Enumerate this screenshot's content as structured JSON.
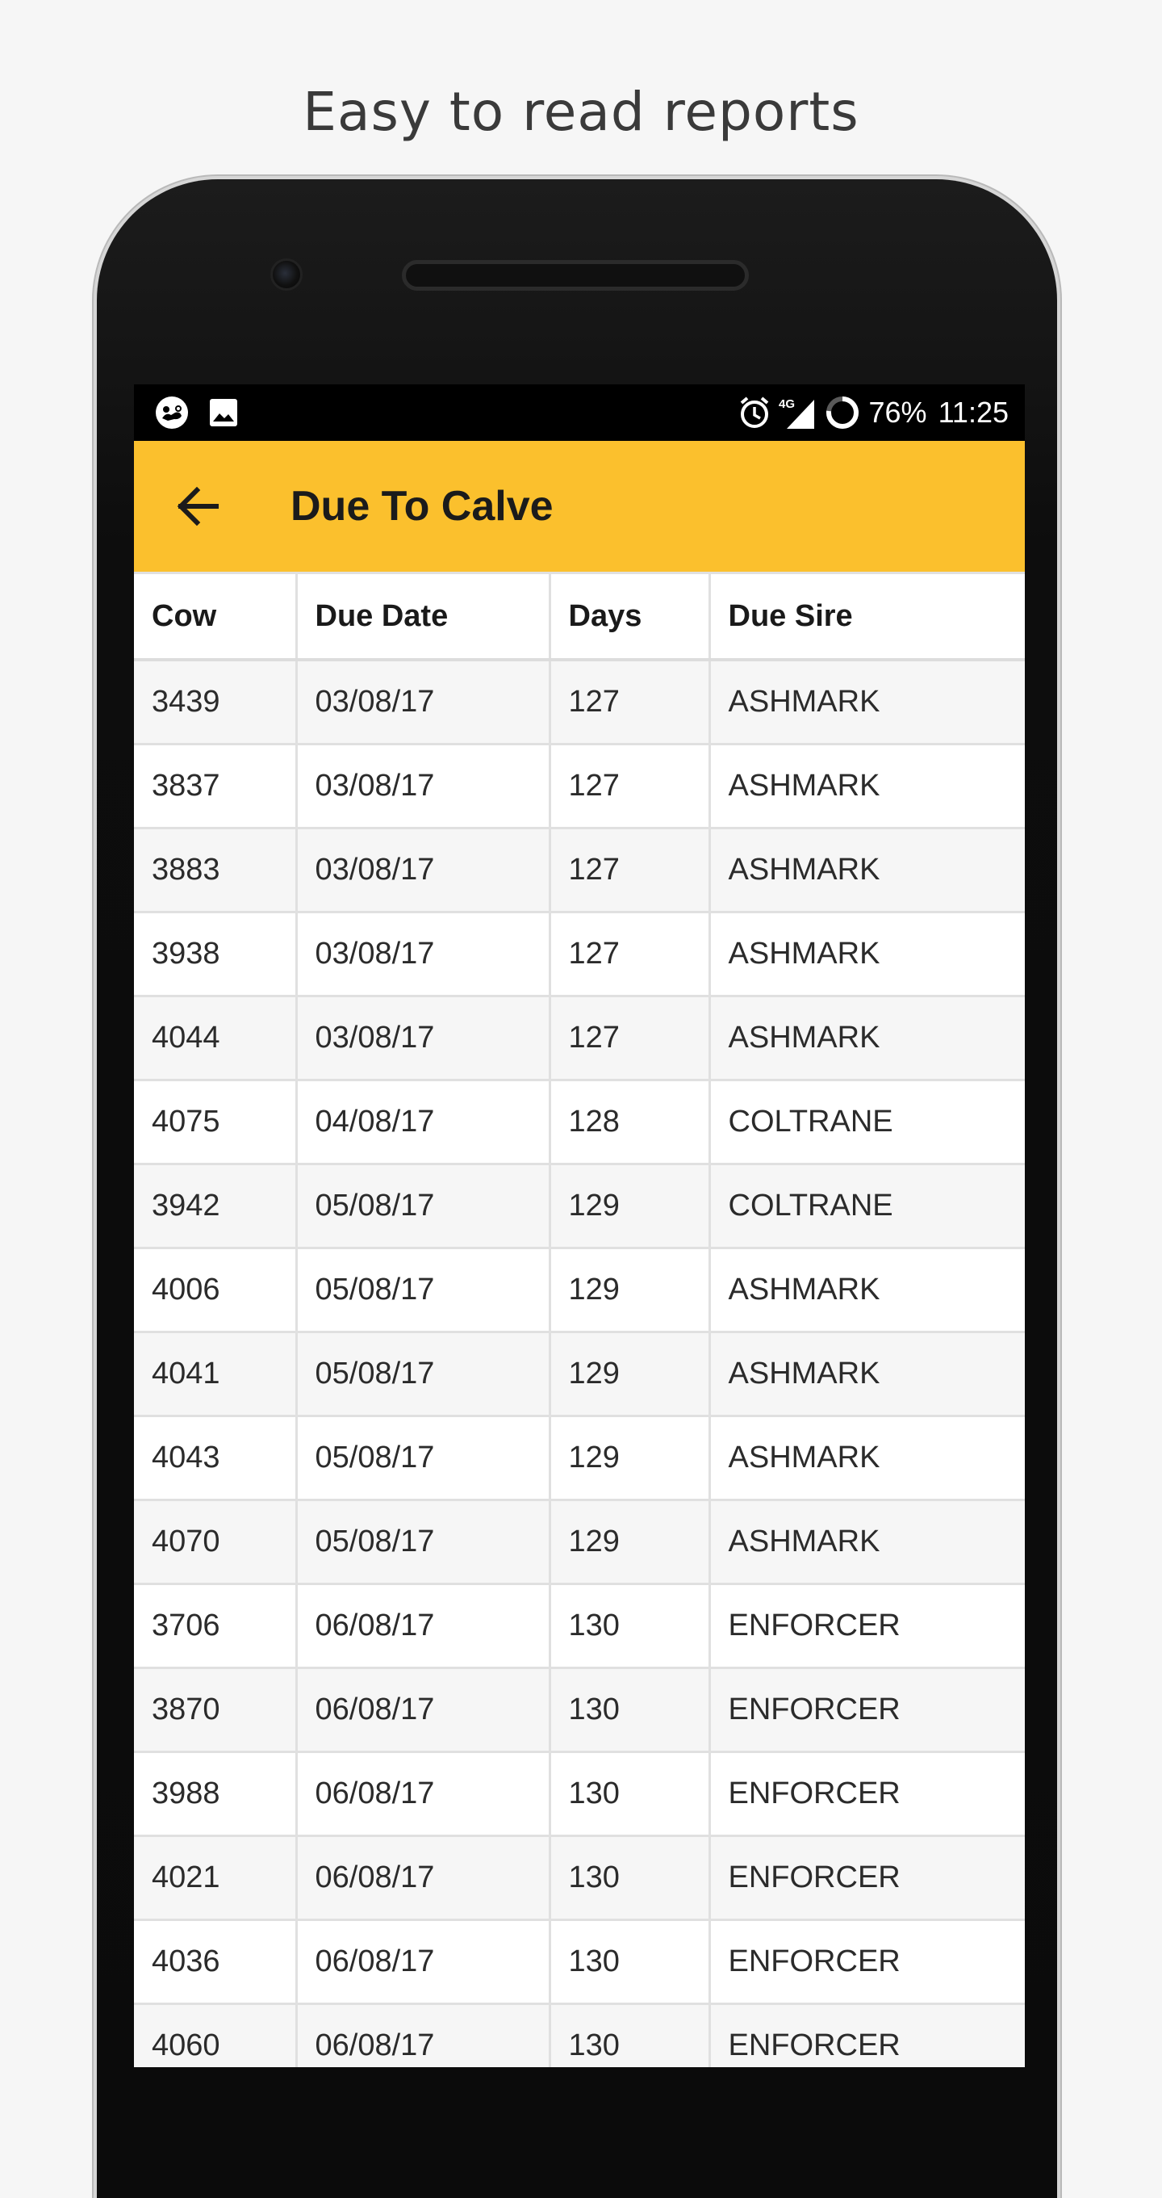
{
  "promo": {
    "title": "Easy to read reports"
  },
  "status_bar": {
    "left_icons": [
      "baby-notification-icon",
      "image-icon"
    ],
    "right_icons": [
      "alarm-icon",
      "4g-signal-icon",
      "battery-icon"
    ],
    "network_label": "4G",
    "battery": "76%",
    "time": "11:25"
  },
  "toolbar": {
    "back_icon": "arrow-back-icon",
    "title": "Due To Calve",
    "background": "#fbc02d"
  },
  "table": {
    "headers": {
      "cow": "Cow",
      "due_date": "Due Date",
      "days": "Days",
      "due_sire": "Due Sire"
    },
    "rows": [
      {
        "cow": "3439",
        "due_date": "03/08/17",
        "days": "127",
        "due_sire": "ASHMARK"
      },
      {
        "cow": "3837",
        "due_date": "03/08/17",
        "days": "127",
        "due_sire": "ASHMARK"
      },
      {
        "cow": "3883",
        "due_date": "03/08/17",
        "days": "127",
        "due_sire": "ASHMARK"
      },
      {
        "cow": "3938",
        "due_date": "03/08/17",
        "days": "127",
        "due_sire": "ASHMARK"
      },
      {
        "cow": "4044",
        "due_date": "03/08/17",
        "days": "127",
        "due_sire": "ASHMARK"
      },
      {
        "cow": "4075",
        "due_date": "04/08/17",
        "days": "128",
        "due_sire": "COLTRANE"
      },
      {
        "cow": "3942",
        "due_date": "05/08/17",
        "days": "129",
        "due_sire": "COLTRANE"
      },
      {
        "cow": "4006",
        "due_date": "05/08/17",
        "days": "129",
        "due_sire": "ASHMARK"
      },
      {
        "cow": "4041",
        "due_date": "05/08/17",
        "days": "129",
        "due_sire": "ASHMARK"
      },
      {
        "cow": "4043",
        "due_date": "05/08/17",
        "days": "129",
        "due_sire": "ASHMARK"
      },
      {
        "cow": "4070",
        "due_date": "05/08/17",
        "days": "129",
        "due_sire": "ASHMARK"
      },
      {
        "cow": "3706",
        "due_date": "06/08/17",
        "days": "130",
        "due_sire": "ENFORCER"
      },
      {
        "cow": "3870",
        "due_date": "06/08/17",
        "days": "130",
        "due_sire": "ENFORCER"
      },
      {
        "cow": "3988",
        "due_date": "06/08/17",
        "days": "130",
        "due_sire": "ENFORCER"
      },
      {
        "cow": "4021",
        "due_date": "06/08/17",
        "days": "130",
        "due_sire": "ENFORCER"
      },
      {
        "cow": "4036",
        "due_date": "06/08/17",
        "days": "130",
        "due_sire": "ENFORCER"
      },
      {
        "cow": "4060",
        "due_date": "06/08/17",
        "days": "130",
        "due_sire": "ENFORCER"
      }
    ]
  }
}
